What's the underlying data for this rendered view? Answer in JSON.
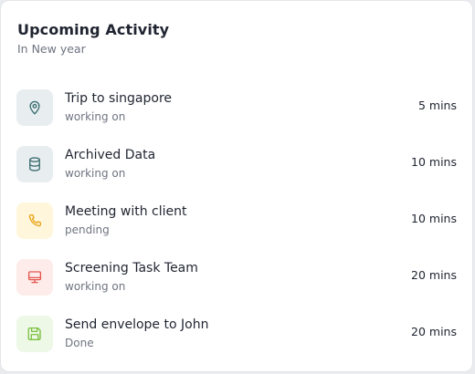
{
  "card": {
    "title": "Upcoming Activity",
    "subtitle": "In New year"
  },
  "activities": [
    {
      "title": "Trip to singapore",
      "status": "working on",
      "duration": "5 mins",
      "icon": "location-pin-icon",
      "icon_color": "#3d6f73",
      "icon_bg": "#e8eef0"
    },
    {
      "title": "Archived Data",
      "status": "working on",
      "duration": "10 mins",
      "icon": "database-icon",
      "icon_color": "#3d6f73",
      "icon_bg": "#e8eef0"
    },
    {
      "title": "Meeting with client",
      "status": "pending",
      "duration": "10 mins",
      "icon": "phone-icon",
      "icon_color": "#e8a317",
      "icon_bg": "#fff6dc"
    },
    {
      "title": "Screening Task Team",
      "status": "working on",
      "duration": "20 mins",
      "icon": "monitor-icon",
      "icon_color": "#e5564f",
      "icon_bg": "#fdecea"
    },
    {
      "title": "Send envelope to John",
      "status": "Done",
      "duration": "20 mins",
      "icon": "save-disk-icon",
      "icon_color": "#7cc142",
      "icon_bg": "#eef8e6"
    }
  ]
}
